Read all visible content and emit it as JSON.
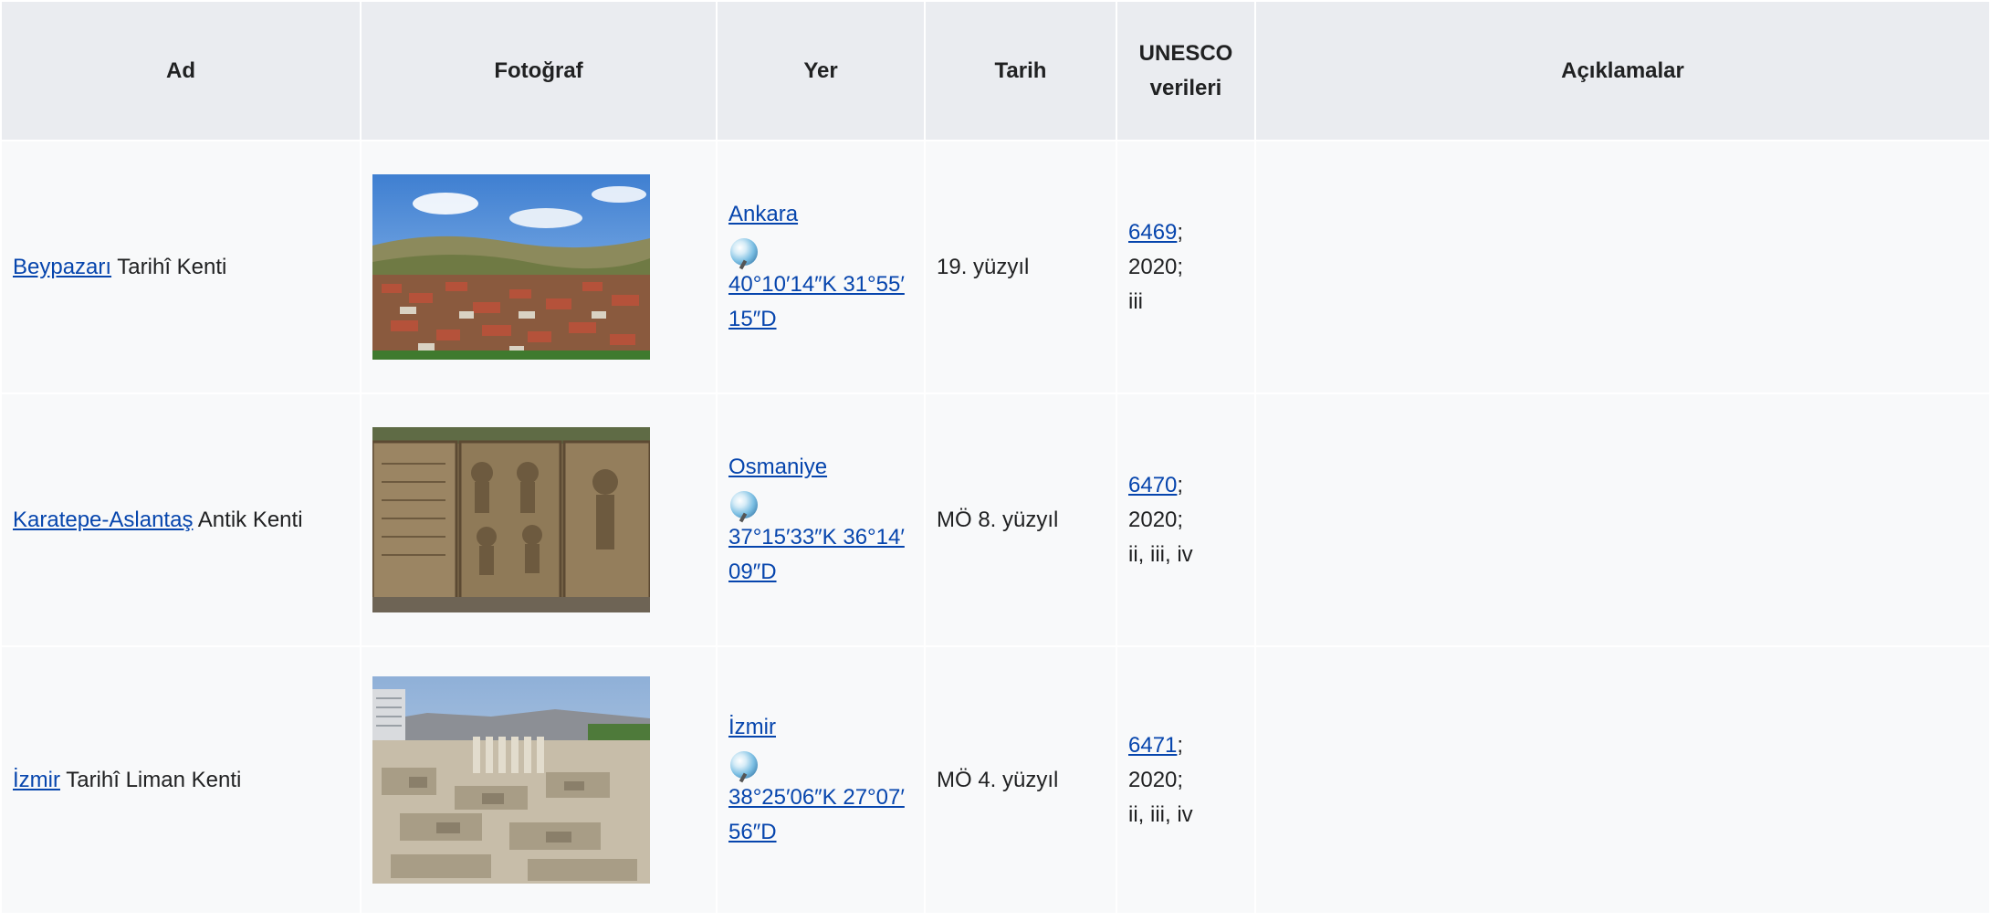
{
  "headers": {
    "name": "Ad",
    "photo": "Fotoğraf",
    "place": "Yer",
    "date": "Tarih",
    "unesco_line1": "UNESCO",
    "unesco_line2": "verileri",
    "notes": "Açıklamalar"
  },
  "rows": [
    {
      "name_link": "Beypazarı",
      "name_rest": " Tarihî Kenti",
      "place": "Ankara",
      "coords": "40°10′14″K 31°55′15″D",
      "date": "19. yüzyıl",
      "unesco_id": "6469",
      "unesco_rest": "; 2020;",
      "criteria": "iii",
      "notes": ""
    },
    {
      "name_link": "Karatepe-Aslantaş",
      "name_rest": " Antik Kenti",
      "place": "Osmaniye",
      "coords": "37°15′33″K 36°14′09″D",
      "date": "MÖ 8. yüzyıl",
      "unesco_id": "6470",
      "unesco_rest": "; 2020;",
      "criteria": "ii, iii, iv",
      "notes": ""
    },
    {
      "name_link": "İzmir",
      "name_rest": " Tarihî Liman Kenti",
      "place": "İzmir",
      "coords": "38°25′06″K 27°07′56″D",
      "date": "MÖ 4. yüzyıl",
      "unesco_id": "6471",
      "unesco_rest": "; 2020;",
      "criteria": "ii, iii, iv",
      "notes": ""
    }
  ],
  "icons": {
    "coordinates": "globe-icon"
  },
  "colors": {
    "link": "#0645ad",
    "header_bg": "#eaecf0",
    "cell_bg": "#f8f9fa"
  }
}
